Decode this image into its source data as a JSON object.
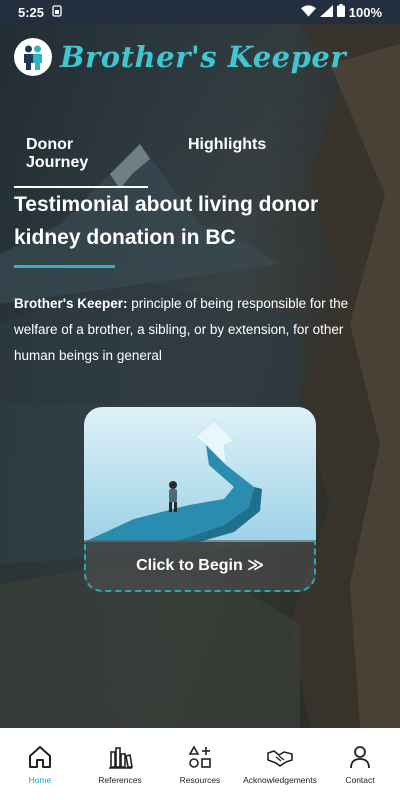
{
  "status_bar": {
    "time": "5:25",
    "battery": "100%"
  },
  "app": {
    "brand_name": "Brother's Keeper"
  },
  "tabs": [
    {
      "label": "Donor Journey",
      "active": true
    },
    {
      "label": "Highlights",
      "active": false
    }
  ],
  "headline": "Testimonial about living donor kidney donation in BC",
  "definition": {
    "term": "Brother's Keeper:",
    "text": " principle of being responsible for the welfare of a brother, a sibling, or by extension, for other human beings in general"
  },
  "card": {
    "cta_label": "Click to Begin ≫"
  },
  "bottom_nav": [
    {
      "label": "Home",
      "icon": "home-icon",
      "active": true
    },
    {
      "label": "References",
      "icon": "books-icon",
      "active": false
    },
    {
      "label": "Resources",
      "icon": "shapes-icon",
      "active": false
    },
    {
      "label": "Acknowledgements",
      "icon": "handshake-icon",
      "active": false
    },
    {
      "label": "Contact",
      "icon": "person-icon",
      "active": false
    }
  ],
  "colors": {
    "accent": "#2fb3bd",
    "brand": "#3fc6cf",
    "status_bar": "#232f3e"
  }
}
